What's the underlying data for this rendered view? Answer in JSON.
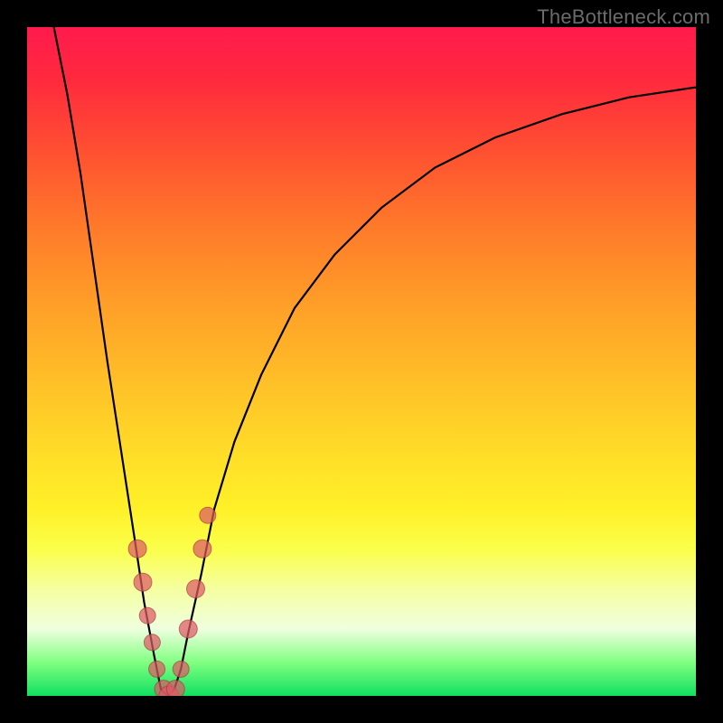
{
  "watermark": "TheBottleneck.com",
  "colors": {
    "frame": "#000000",
    "curve": "#000000",
    "marker_fill": "rgba(220,90,100,0.72)",
    "marker_stroke": "rgba(155,50,60,0.6)"
  },
  "chart_data": {
    "type": "line",
    "title": "",
    "xlabel": "",
    "ylabel": "",
    "xlim": [
      0,
      100
    ],
    "ylim": [
      0,
      100
    ],
    "grid": false,
    "series": [
      {
        "name": "bottleneck-curve",
        "x": [
          4,
          6,
          8,
          10,
          12,
          14,
          16,
          17.5,
          19,
          20,
          21,
          22,
          23,
          24,
          26,
          28,
          31,
          35,
          40,
          46,
          53,
          61,
          70,
          80,
          90,
          100
        ],
        "values": [
          100,
          90,
          78,
          64,
          50,
          37,
          24,
          14,
          6,
          1,
          0,
          1,
          4,
          9,
          18,
          28,
          38,
          48,
          58,
          66,
          73,
          79,
          83.5,
          87,
          89.5,
          91
        ]
      }
    ],
    "markers": {
      "name": "highlighted-points",
      "x": [
        16.5,
        17.3,
        18.0,
        18.7,
        19.4,
        20.4,
        21.2,
        22.2,
        23.0,
        24.1,
        25.2,
        26.2,
        27.0
      ],
      "values": [
        22,
        17,
        12,
        8,
        4,
        1,
        0,
        1,
        4,
        10,
        16,
        22,
        27
      ],
      "r": [
        10,
        10,
        9,
        9,
        9,
        10,
        11,
        10,
        9,
        10,
        10,
        10,
        9
      ]
    }
  }
}
